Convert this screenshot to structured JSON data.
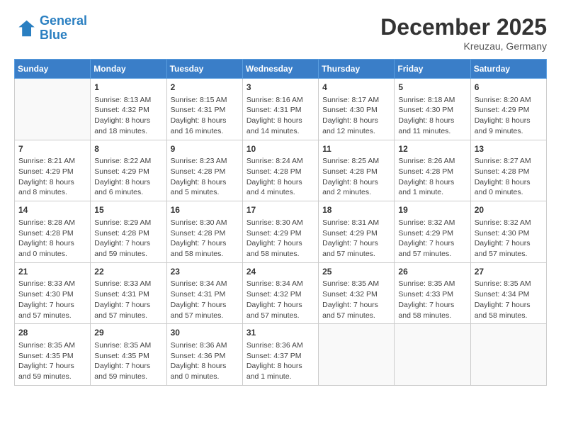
{
  "header": {
    "logo_general": "General",
    "logo_blue": "Blue",
    "month_year": "December 2025",
    "location": "Kreuzau, Germany"
  },
  "days_of_week": [
    "Sunday",
    "Monday",
    "Tuesday",
    "Wednesday",
    "Thursday",
    "Friday",
    "Saturday"
  ],
  "weeks": [
    [
      {
        "day": "",
        "info": ""
      },
      {
        "day": "1",
        "info": "Sunrise: 8:13 AM\nSunset: 4:32 PM\nDaylight: 8 hours\nand 18 minutes."
      },
      {
        "day": "2",
        "info": "Sunrise: 8:15 AM\nSunset: 4:31 PM\nDaylight: 8 hours\nand 16 minutes."
      },
      {
        "day": "3",
        "info": "Sunrise: 8:16 AM\nSunset: 4:31 PM\nDaylight: 8 hours\nand 14 minutes."
      },
      {
        "day": "4",
        "info": "Sunrise: 8:17 AM\nSunset: 4:30 PM\nDaylight: 8 hours\nand 12 minutes."
      },
      {
        "day": "5",
        "info": "Sunrise: 8:18 AM\nSunset: 4:30 PM\nDaylight: 8 hours\nand 11 minutes."
      },
      {
        "day": "6",
        "info": "Sunrise: 8:20 AM\nSunset: 4:29 PM\nDaylight: 8 hours\nand 9 minutes."
      }
    ],
    [
      {
        "day": "7",
        "info": "Sunrise: 8:21 AM\nSunset: 4:29 PM\nDaylight: 8 hours\nand 8 minutes."
      },
      {
        "day": "8",
        "info": "Sunrise: 8:22 AM\nSunset: 4:29 PM\nDaylight: 8 hours\nand 6 minutes."
      },
      {
        "day": "9",
        "info": "Sunrise: 8:23 AM\nSunset: 4:28 PM\nDaylight: 8 hours\nand 5 minutes."
      },
      {
        "day": "10",
        "info": "Sunrise: 8:24 AM\nSunset: 4:28 PM\nDaylight: 8 hours\nand 4 minutes."
      },
      {
        "day": "11",
        "info": "Sunrise: 8:25 AM\nSunset: 4:28 PM\nDaylight: 8 hours\nand 2 minutes."
      },
      {
        "day": "12",
        "info": "Sunrise: 8:26 AM\nSunset: 4:28 PM\nDaylight: 8 hours\nand 1 minute."
      },
      {
        "day": "13",
        "info": "Sunrise: 8:27 AM\nSunset: 4:28 PM\nDaylight: 8 hours\nand 0 minutes."
      }
    ],
    [
      {
        "day": "14",
        "info": "Sunrise: 8:28 AM\nSunset: 4:28 PM\nDaylight: 8 hours\nand 0 minutes."
      },
      {
        "day": "15",
        "info": "Sunrise: 8:29 AM\nSunset: 4:28 PM\nDaylight: 7 hours\nand 59 minutes."
      },
      {
        "day": "16",
        "info": "Sunrise: 8:30 AM\nSunset: 4:28 PM\nDaylight: 7 hours\nand 58 minutes."
      },
      {
        "day": "17",
        "info": "Sunrise: 8:30 AM\nSunset: 4:29 PM\nDaylight: 7 hours\nand 58 minutes."
      },
      {
        "day": "18",
        "info": "Sunrise: 8:31 AM\nSunset: 4:29 PM\nDaylight: 7 hours\nand 57 minutes."
      },
      {
        "day": "19",
        "info": "Sunrise: 8:32 AM\nSunset: 4:29 PM\nDaylight: 7 hours\nand 57 minutes."
      },
      {
        "day": "20",
        "info": "Sunrise: 8:32 AM\nSunset: 4:30 PM\nDaylight: 7 hours\nand 57 minutes."
      }
    ],
    [
      {
        "day": "21",
        "info": "Sunrise: 8:33 AM\nSunset: 4:30 PM\nDaylight: 7 hours\nand 57 minutes."
      },
      {
        "day": "22",
        "info": "Sunrise: 8:33 AM\nSunset: 4:31 PM\nDaylight: 7 hours\nand 57 minutes."
      },
      {
        "day": "23",
        "info": "Sunrise: 8:34 AM\nSunset: 4:31 PM\nDaylight: 7 hours\nand 57 minutes."
      },
      {
        "day": "24",
        "info": "Sunrise: 8:34 AM\nSunset: 4:32 PM\nDaylight: 7 hours\nand 57 minutes."
      },
      {
        "day": "25",
        "info": "Sunrise: 8:35 AM\nSunset: 4:32 PM\nDaylight: 7 hours\nand 57 minutes."
      },
      {
        "day": "26",
        "info": "Sunrise: 8:35 AM\nSunset: 4:33 PM\nDaylight: 7 hours\nand 58 minutes."
      },
      {
        "day": "27",
        "info": "Sunrise: 8:35 AM\nSunset: 4:34 PM\nDaylight: 7 hours\nand 58 minutes."
      }
    ],
    [
      {
        "day": "28",
        "info": "Sunrise: 8:35 AM\nSunset: 4:35 PM\nDaylight: 7 hours\nand 59 minutes."
      },
      {
        "day": "29",
        "info": "Sunrise: 8:35 AM\nSunset: 4:35 PM\nDaylight: 7 hours\nand 59 minutes."
      },
      {
        "day": "30",
        "info": "Sunrise: 8:36 AM\nSunset: 4:36 PM\nDaylight: 8 hours\nand 0 minutes."
      },
      {
        "day": "31",
        "info": "Sunrise: 8:36 AM\nSunset: 4:37 PM\nDaylight: 8 hours\nand 1 minute."
      },
      {
        "day": "",
        "info": ""
      },
      {
        "day": "",
        "info": ""
      },
      {
        "day": "",
        "info": ""
      }
    ]
  ]
}
